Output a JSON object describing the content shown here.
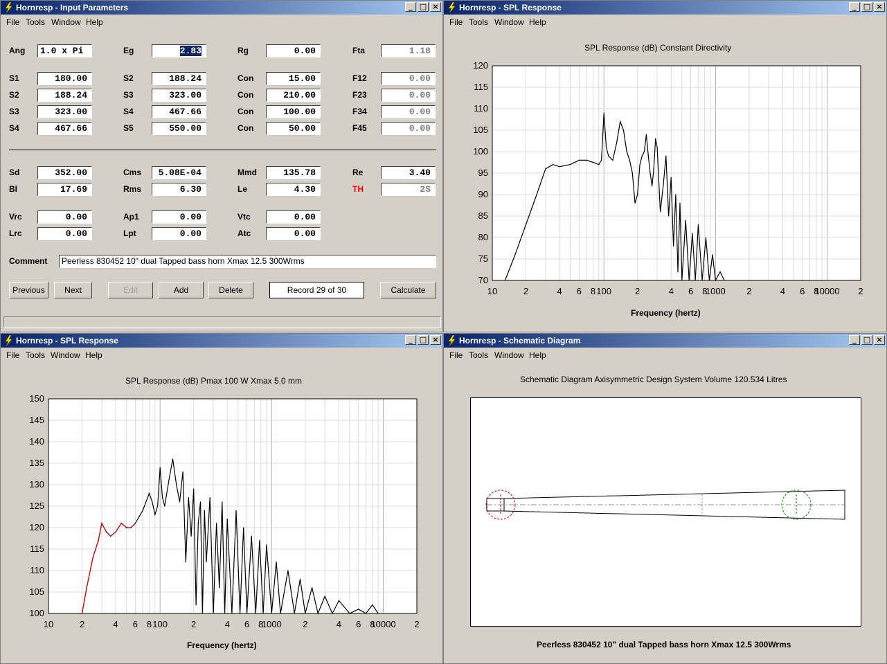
{
  "menus": {
    "file": "File",
    "tools": "Tools",
    "window": "Window",
    "help": "Help"
  },
  "input_window": {
    "title": "Hornresp - Input Parameters",
    "fields": [
      {
        "label": "Ang",
        "value": "1.0 x Pi",
        "align": "left"
      },
      {
        "label": "Eg",
        "value": "2.83",
        "selected": true
      },
      {
        "label": "Rg",
        "value": "0.00"
      },
      {
        "label": "Fta",
        "value": "1.18",
        "grey": true
      },
      {
        "label": "S1",
        "value": "180.00"
      },
      {
        "label": "S2",
        "value": "188.24"
      },
      {
        "label": "Con",
        "value": "15.00"
      },
      {
        "label": "F12",
        "value": "0.00",
        "grey": true
      },
      {
        "label": "S2",
        "value": "188.24"
      },
      {
        "label": "S3",
        "value": "323.00"
      },
      {
        "label": "Con",
        "value": "210.00"
      },
      {
        "label": "F23",
        "value": "0.00",
        "grey": true
      },
      {
        "label": "S3",
        "value": "323.00"
      },
      {
        "label": "S4",
        "value": "467.66"
      },
      {
        "label": "Con",
        "value": "100.00"
      },
      {
        "label": "F34",
        "value": "0.00",
        "grey": true
      },
      {
        "label": "S4",
        "value": "467.66"
      },
      {
        "label": "S5",
        "value": "550.00"
      },
      {
        "label": "Con",
        "value": "50.00"
      },
      {
        "label": "F45",
        "value": "0.00",
        "grey": true
      },
      {
        "label": "Sd",
        "value": "352.00"
      },
      {
        "label": "Cms",
        "value": "5.08E-04"
      },
      {
        "label": "Mmd",
        "value": "135.78"
      },
      {
        "label": "Re",
        "value": "3.40"
      },
      {
        "label": "Bl",
        "value": "17.69"
      },
      {
        "label": "Rms",
        "value": "6.30"
      },
      {
        "label": "Le",
        "value": "4.30"
      },
      {
        "label": "TH",
        "value": "2S",
        "grey": true,
        "red_label": true
      },
      {
        "label": "Vrc",
        "value": "0.00"
      },
      {
        "label": "Ap1",
        "value": "0.00"
      },
      {
        "label": "Vtc",
        "value": "0.00"
      },
      {
        "label": "Lrc",
        "value": "0.00"
      },
      {
        "label": "Lpt",
        "value": "0.00"
      },
      {
        "label": "Atc",
        "value": "0.00"
      }
    ],
    "comment_label": "Comment",
    "comment_value": "Peerless 830452 10\" dual Tapped bass horn Xmax 12.5 300Wrms",
    "buttons": {
      "previous": "Previous",
      "next": "Next",
      "edit": "Edit",
      "add": "Add",
      "delete": "Delete",
      "calculate": "Calculate"
    },
    "record": "Record 29 of 30"
  },
  "spl_top": {
    "title": "Hornresp - SPL Response",
    "chart_title": "SPL Response (dB)   Constant Directivity",
    "xlabel": "Frequency (hertz)",
    "y_ticks": [
      "120",
      "115",
      "110",
      "105",
      "100",
      "95",
      "90",
      "85",
      "80",
      "75",
      "70"
    ],
    "x_ticks": [
      "10",
      "2",
      "4",
      "6",
      "8",
      "100",
      "2",
      "4",
      "6",
      "8",
      "1000",
      "2",
      "4",
      "6",
      "8",
      "10000",
      "2"
    ]
  },
  "spl_bottom": {
    "title": "Hornresp - SPL Response",
    "chart_title": "SPL Response (dB)   Pmax 100 W   Xmax 5.0 mm",
    "xlabel": "Frequency (hertz)",
    "y_ticks": [
      "150",
      "145",
      "140",
      "135",
      "130",
      "125",
      "120",
      "115",
      "110",
      "105",
      "100"
    ],
    "x_ticks": [
      "10",
      "2",
      "4",
      "6",
      "8",
      "100",
      "2",
      "4",
      "6",
      "8",
      "1000",
      "2",
      "4",
      "6",
      "8",
      "10000",
      "2"
    ]
  },
  "schematic": {
    "title": "Hornresp - Schematic Diagram",
    "chart_title": "Schematic Diagram   Axisymmetric Design   System Volume 120.534 Litres",
    "caption": "Peerless 830452 10\" dual Tapped bass horn Xmax 12.5 300Wrms"
  },
  "chart_data": [
    {
      "type": "line",
      "title": "SPL Response (dB)   Constant Directivity",
      "xlabel": "Frequency (hertz)",
      "ylabel": "",
      "x_scale": "log",
      "xlim": [
        10,
        20000
      ],
      "ylim": [
        70,
        120
      ],
      "grid": true,
      "series": [
        {
          "x": [
            13,
            16,
            20,
            25,
            30,
            35,
            40,
            50,
            60,
            70,
            80,
            90,
            95,
            100,
            105,
            110,
            120,
            130,
            140,
            150,
            160,
            170,
            180,
            190,
            200,
            210,
            220,
            230,
            240,
            250,
            260,
            270,
            280,
            290,
            300,
            320,
            340,
            360,
            380,
            400,
            420,
            440,
            460,
            480,
            500,
            540,
            580,
            620,
            660,
            700,
            760,
            820,
            880,
            940,
            1000,
            1100,
            1200
          ],
          "y": [
            70,
            76,
            83,
            90,
            96,
            97,
            96.5,
            97,
            98,
            98,
            97.5,
            97,
            98,
            109,
            101,
            99,
            98,
            102,
            107,
            105,
            100,
            98,
            95,
            88,
            90,
            97,
            99,
            100,
            104,
            99,
            95,
            92,
            96,
            103,
            101,
            86,
            92,
            99,
            85,
            94,
            78,
            90,
            72,
            88,
            70,
            84,
            70,
            81,
            70,
            83,
            70,
            80,
            70,
            76,
            70,
            72,
            70
          ]
        }
      ]
    },
    {
      "type": "line",
      "title": "SPL Response (dB)   Pmax 100 W   Xmax 5.0 mm",
      "xlabel": "Frequency (hertz)",
      "ylabel": "",
      "x_scale": "log",
      "xlim": [
        10,
        20000
      ],
      "ylim": [
        100,
        150
      ],
      "grid": true,
      "series": [
        {
          "x": [
            20,
            22,
            25,
            28,
            30,
            33,
            36,
            40,
            45,
            50,
            55,
            60,
            70,
            80,
            85,
            90,
            95,
            100,
            105,
            110,
            120,
            130,
            140,
            150,
            160,
            170,
            180,
            190,
            200,
            210,
            220,
            230,
            240,
            250,
            260,
            280,
            300,
            320,
            340,
            360,
            380,
            400,
            440,
            480,
            520,
            560,
            600,
            660,
            720,
            780,
            840,
            900,
            1000,
            1100,
            1200,
            1400,
            1600,
            1800,
            2000,
            2300,
            2600,
            3000,
            3500,
            4000,
            5000,
            6000,
            7000,
            8000,
            9000
          ],
          "y": [
            100,
            106,
            113,
            117,
            121,
            119,
            118,
            119,
            121,
            120,
            120,
            121,
            124,
            128,
            126,
            123,
            125,
            134,
            127,
            125,
            131,
            136,
            130,
            126,
            133,
            112,
            127,
            118,
            129,
            102,
            121,
            126,
            100,
            124,
            112,
            127,
            100,
            121,
            106,
            126,
            100,
            122,
            100,
            124,
            100,
            120,
            100,
            118,
            100,
            117,
            100,
            116,
            100,
            112,
            100,
            110,
            100,
            108,
            100,
            106,
            100,
            104,
            100,
            103,
            100,
            101,
            100,
            102,
            100
          ]
        }
      ]
    }
  ]
}
